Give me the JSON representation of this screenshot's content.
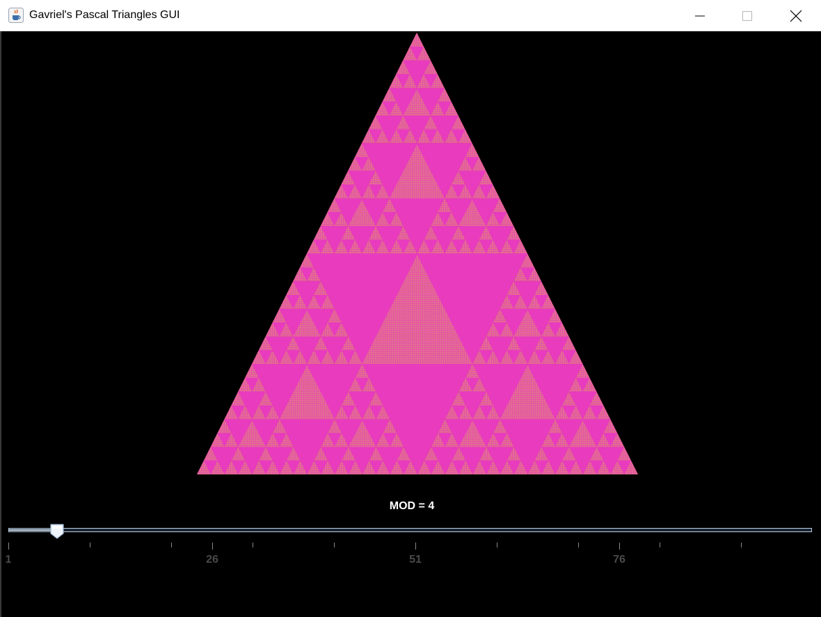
{
  "window": {
    "title": "Gavriel's Pascal Triangles GUI",
    "app_icon": "java-cup-icon",
    "controls": [
      "minimize-icon",
      "maximize-icon",
      "close-icon"
    ]
  },
  "triangle": {
    "description_icon": "pascal-triangle-mod-fractal",
    "colors": {
      "fill": "#e83bbd",
      "zero_cells": "#c8185a",
      "texture": "#e38a9a",
      "background": "#000000"
    },
    "modulus": 4
  },
  "slider": {
    "label": "MOD = 4",
    "min": 1,
    "max": 100,
    "value": 4,
    "major_tick_labels": [
      "1",
      "26",
      "51",
      "76"
    ],
    "track_color": "#b8cfe5"
  }
}
